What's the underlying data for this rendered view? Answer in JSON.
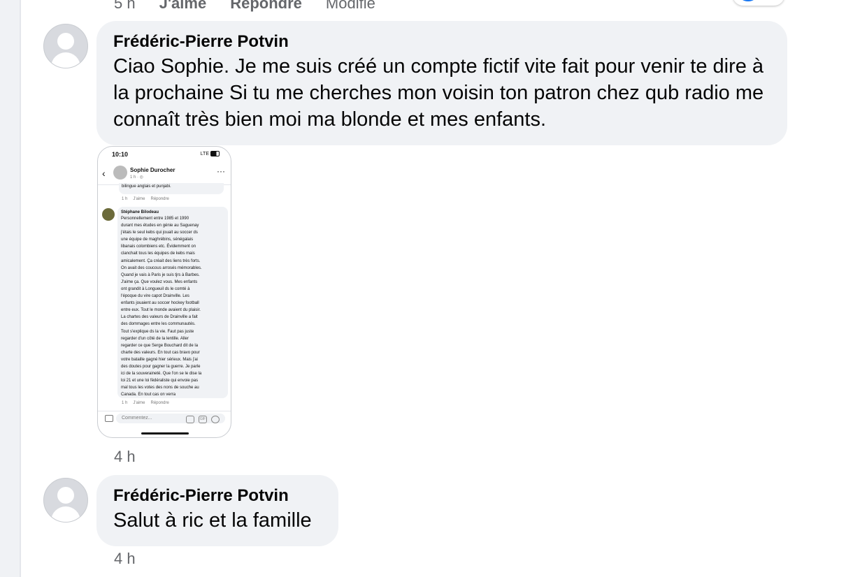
{
  "top_bar": {
    "time": "5 h",
    "like": "J'aime",
    "reply": "Répondre",
    "edit": "Modifié"
  },
  "comments": [
    {
      "author": "Frédéric-Pierre Potvin",
      "text": "Ciao Sophie. Je me suis créé un compte fictif vite fait pour venir te dire à la prochaine Si tu me cherches mon voisin ton patron chez qub radio me connaît très bien moi ma blonde et mes enfants.",
      "time": "4 h"
    },
    {
      "author": "Frédéric-Pierre Potvin",
      "text": "Salut à ric et la famille",
      "time": "4 h"
    }
  ],
  "screenshot": {
    "status_time": "10:10",
    "status_signal": "LTE",
    "post_author": "Sophie Durocher",
    "post_meta": "1 h · ◎",
    "prev_comment_tail": "bilingue anglais et punjabi.",
    "prev_actions": {
      "time": "1 h",
      "like": "J'aime",
      "reply": "Répondre"
    },
    "commenter": "Stéphane Bilodeau",
    "comment": "Personnellement entre 1985 et 1990\ndurant mes études en génie au Saguenay\nj'étais le seul kebs qui jouait au soccer ds\nune équipe de maghrébins, sénégalais\nlibanais colombiens etc. Évidemment on\nclanchait tous les équipes de kebs mais\namicalement. Ça créait des liens très forts.\nOn avait des coucous arrosés mémorables.\nQuand je vais à Paris je suis tjrs à Barbes.\nJ'aime ça. Que voulez vous. Mes enfants\nont grandit à Longueuil ds le comté à\nl'époque du vire capot Drainville. Les\nenfants jouaient au soccer hockey football\nentre eux.  Tout le monde avaient du plaisir.\nLa chartes des valeurs de Drainville a fait\ndes dommages entre les communautés.\nTout s'explique ds la vie. Faut pas juste\nregarder d'un côté de la lentille. Aller\nregarder ce que Serge Bouchard dit de la\ncharte des valeurs. En tout cas bravo pour\nvotre bataille gagné hier sérieux. Mais j'ai\ndes doutes pour gagner la guerre. Je parle\nici de la souveraineté. Que l'on se le dise la\nloi 21 et une loi fédéraliste qui envoie pas\nmal tous les votes des nons de souche au\nCanada. En tout cas on verra",
    "comment_actions": {
      "time": "1 h",
      "like": "J'aime",
      "reply": "Répondre"
    },
    "input_placeholder": "Commentez...",
    "gif_label": "GIF"
  }
}
